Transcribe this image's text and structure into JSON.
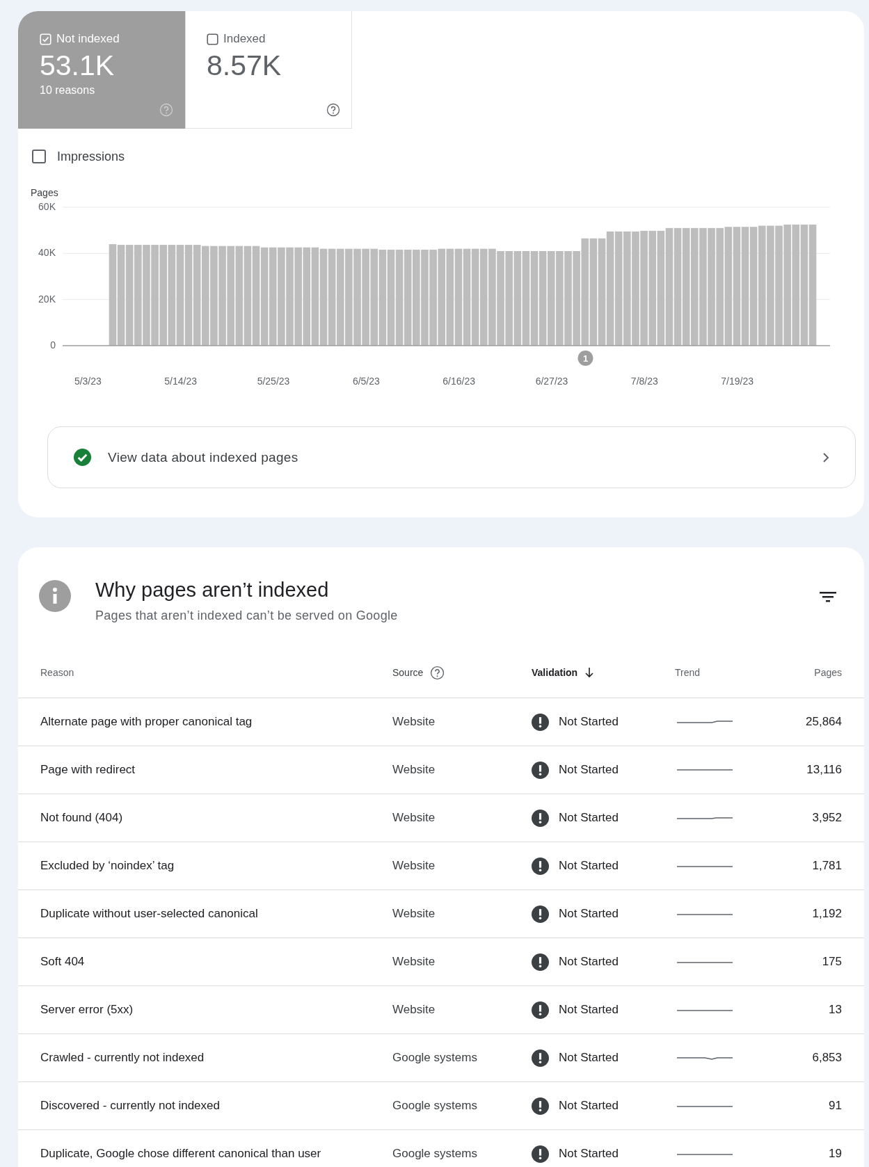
{
  "tabs": [
    {
      "label": "Not indexed",
      "value": "53.1K",
      "sublabel": "10 reasons",
      "selected": true
    },
    {
      "label": "Indexed",
      "value": "8.57K",
      "selected": false
    }
  ],
  "impressions": {
    "label": "Impressions",
    "checked": false
  },
  "chart": {
    "chart_data": {
      "type": "bar",
      "ylabel": "Pages",
      "categories": [
        "5/3/23",
        null,
        null,
        null,
        null,
        null,
        null,
        null,
        null,
        null,
        null,
        "5/14/23",
        null,
        null,
        null,
        null,
        null,
        null,
        null,
        null,
        null,
        null,
        "5/25/23",
        null,
        null,
        null,
        null,
        null,
        null,
        null,
        null,
        null,
        null,
        "6/5/23",
        null,
        null,
        null,
        null,
        null,
        null,
        null,
        null,
        null,
        null,
        "6/16/23",
        null,
        null,
        null,
        null,
        null,
        null,
        null,
        null,
        null,
        null,
        "6/27/23",
        null,
        null,
        null,
        null,
        null,
        null,
        null,
        null,
        null,
        null,
        "7/8/23",
        null,
        null,
        null,
        null,
        null,
        null,
        null,
        null,
        null,
        null,
        "7/19/23",
        null,
        null,
        null,
        null,
        null,
        null,
        null,
        null,
        null
      ],
      "values": [
        null,
        null,
        null,
        44000,
        43700,
        43700,
        43700,
        43700,
        43700,
        43700,
        43700,
        43700,
        43700,
        43700,
        43200,
        43200,
        43200,
        43200,
        43200,
        43200,
        43200,
        42600,
        42600,
        42600,
        42600,
        42600,
        42600,
        42600,
        42000,
        42000,
        42000,
        42000,
        42000,
        42000,
        42000,
        41600,
        41600,
        41600,
        41600,
        41600,
        41600,
        41600,
        42000,
        42000,
        42000,
        42000,
        42000,
        42000,
        42000,
        41000,
        41000,
        41000,
        41000,
        41000,
        41000,
        41000,
        41000,
        41000,
        41000,
        46500,
        46500,
        46500,
        49500,
        49500,
        49500,
        49500,
        49800,
        49800,
        49800,
        51000,
        51000,
        51000,
        51000,
        51000,
        51000,
        51000,
        51500,
        51500,
        51500,
        51500,
        52000,
        52000,
        52000,
        52500,
        52500,
        52500,
        52500
      ],
      "ylim": [
        0,
        60000
      ],
      "yticks": [
        {
          "value": 0,
          "label": "0"
        },
        {
          "value": 20000,
          "label": "20K"
        },
        {
          "value": 40000,
          "label": "40K"
        },
        {
          "value": 60000,
          "label": "60K"
        }
      ],
      "annotations": [
        {
          "text": "1"
        }
      ]
    }
  },
  "link": {
    "label": "View data about indexed pages"
  },
  "section": {
    "title": "Why pages aren’t indexed",
    "subtitle": "Pages that aren’t indexed can’t be served on Google"
  },
  "table": {
    "columns": [
      {
        "label": "Reason",
        "sorted": false,
        "help": false
      },
      {
        "label": "Source",
        "sorted": false,
        "help": true
      },
      {
        "label": "Validation",
        "sorted": true,
        "help": false
      },
      {
        "label": "Trend",
        "sorted": false,
        "help": false
      },
      {
        "label": "Pages",
        "sorted": false,
        "help": false
      }
    ],
    "rows": [
      {
        "reason": "Alternate page with proper canonical tag",
        "source": "Website",
        "validation": "Not Started",
        "pages": "25,864"
      },
      {
        "reason": "Page with redirect",
        "source": "Website",
        "validation": "Not Started",
        "pages": "13,116"
      },
      {
        "reason": "Not found (404)",
        "source": "Website",
        "validation": "Not Started",
        "pages": "3,952"
      },
      {
        "reason": "Excluded by ‘noindex’ tag",
        "source": "Website",
        "validation": "Not Started",
        "pages": "1,781"
      },
      {
        "reason": "Duplicate without user-selected canonical",
        "source": "Website",
        "validation": "Not Started",
        "pages": "1,192"
      },
      {
        "reason": "Soft 404",
        "source": "Website",
        "validation": "Not Started",
        "pages": "175"
      },
      {
        "reason": "Server error (5xx)",
        "source": "Website",
        "validation": "Not Started",
        "pages": "13"
      },
      {
        "reason": "Crawled - currently not indexed",
        "source": "Google systems",
        "validation": "Not Started",
        "pages": "6,853"
      },
      {
        "reason": "Discovered - currently not indexed",
        "source": "Google systems",
        "validation": "Not Started",
        "pages": "91"
      },
      {
        "reason": "Duplicate, Google chose different canonical than user",
        "source": "Google systems",
        "validation": "Not Started",
        "pages": "19"
      }
    ]
  }
}
